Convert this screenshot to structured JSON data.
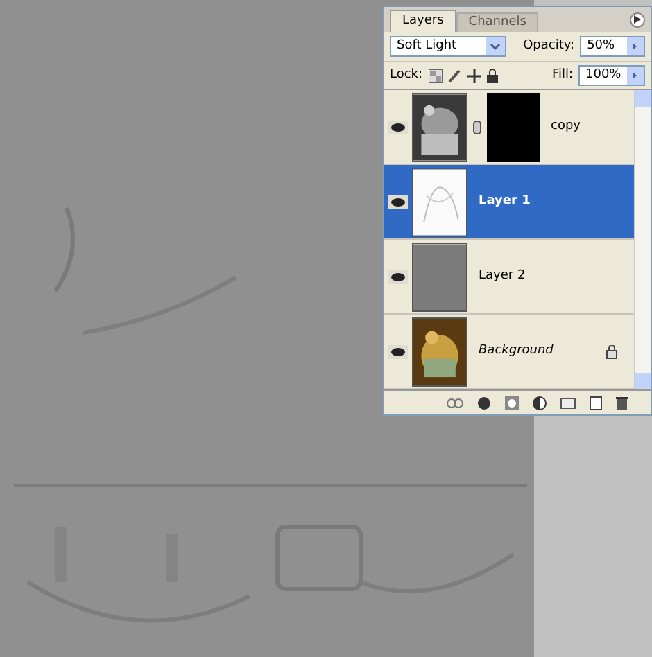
{
  "panel": {
    "tabs": [
      {
        "label": "Layers",
        "selected": true
      },
      {
        "label": "Channels",
        "selected": false
      }
    ],
    "blend_mode": "Soft Light",
    "opacity_label": "Opacity:",
    "opacity": "50%",
    "lock_label": "Lock:",
    "fill_label": "Fill:",
    "fill": "100%",
    "layers": [
      {
        "name": "copy",
        "visible": true,
        "selected": false,
        "locked": false,
        "has_mask": true,
        "kind": "photo-gray"
      },
      {
        "name": "Layer 1",
        "visible": true,
        "selected": true,
        "locked": false,
        "has_mask": false,
        "kind": "sketch"
      },
      {
        "name": "Layer 2",
        "visible": true,
        "selected": false,
        "locked": false,
        "has_mask": false,
        "kind": "gray"
      },
      {
        "name": "Background",
        "visible": true,
        "selected": false,
        "locked": true,
        "has_mask": false,
        "kind": "photo-color"
      }
    ]
  }
}
